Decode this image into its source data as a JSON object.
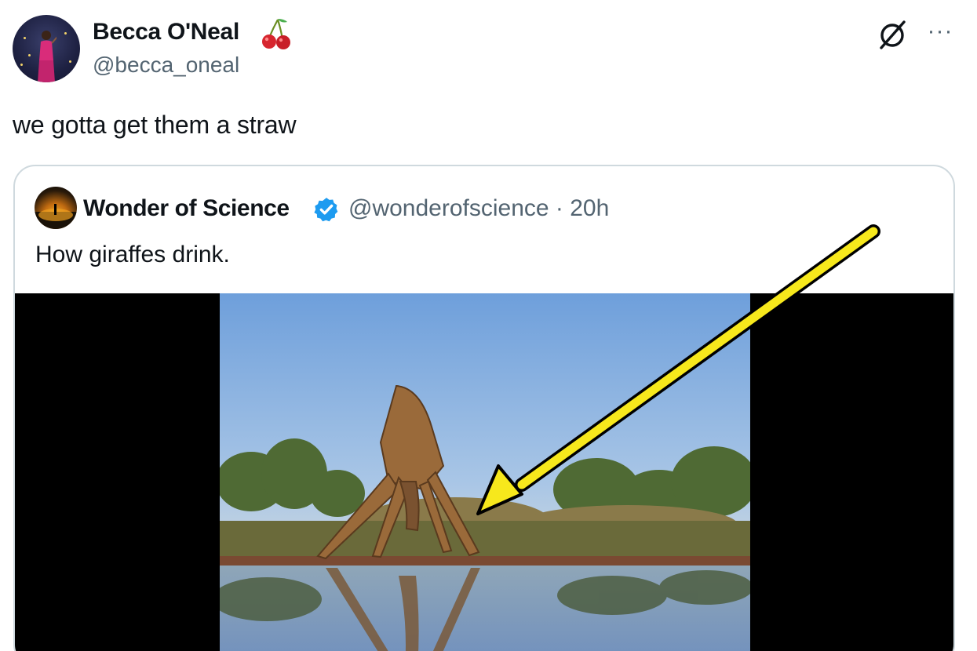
{
  "tweet": {
    "author": {
      "name": "Becca O'Neal",
      "handle": "@becca_oneal",
      "emoji_icon": "cherry-icon"
    },
    "text": "we gotta get them a straw",
    "actions": {
      "grok_icon": "grok-icon",
      "more_icon": "more-icon",
      "more_label": "···"
    },
    "quoted_tweet": {
      "author": {
        "name": "Wonder of Science",
        "handle": "@wonderofscience",
        "verified": true,
        "verified_icon": "verified-badge-icon"
      },
      "meta": "@wonderofscience · 20h",
      "text": "How giraffes drink.",
      "media": {
        "type": "video",
        "subject": "giraffe drinking at waterhole",
        "annotation": "yellow-arrow"
      }
    }
  },
  "colors": {
    "text": "#0f1419",
    "secondary_text": "#536471",
    "border": "#cfd9de",
    "verified_blue": "#1d9bf0",
    "arrow_yellow": "#f7e81c"
  }
}
